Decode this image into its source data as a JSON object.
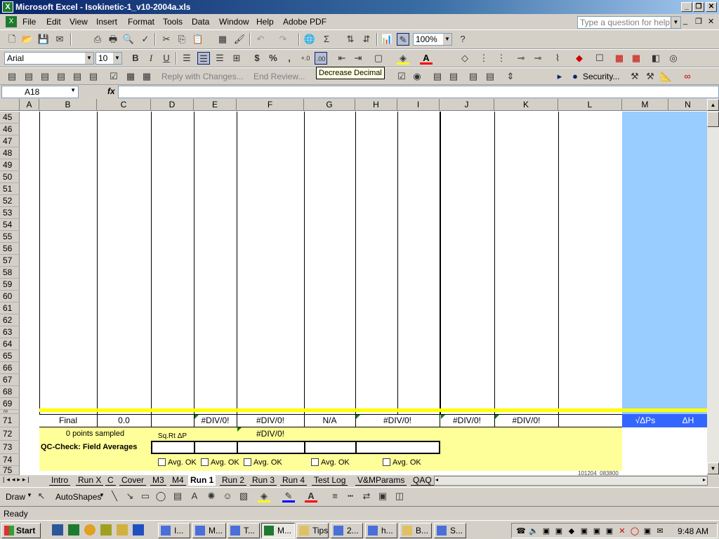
{
  "title": "Microsoft Excel - Isokinetic-1_v10-2004a.xls",
  "menu": [
    "File",
    "Edit",
    "View",
    "Insert",
    "Format",
    "Tools",
    "Data",
    "Window",
    "Help",
    "Adobe PDF"
  ],
  "help_placeholder": "Type a question for help",
  "toolbar": {
    "zoom": "100%",
    "font": "Arial",
    "size": "10",
    "reply_label": "Reply with Changes...",
    "end_review_label": "End Review...",
    "security_label": "Security...",
    "tooltip": "Decrease Decimal"
  },
  "namebox": "A18",
  "fx_label": "fx",
  "columns": [
    "A",
    "B",
    "C",
    "D",
    "E",
    "F",
    "G",
    "H",
    "I",
    "J",
    "K",
    "L",
    "M",
    "N"
  ],
  "rows": [
    "45",
    "46",
    "47",
    "48",
    "49",
    "50",
    "51",
    "52",
    "53",
    "54",
    "55",
    "56",
    "57",
    "58",
    "59",
    "60",
    "61",
    "62",
    "63",
    "64",
    "65",
    "66",
    "67",
    "68",
    "69",
    "70",
    "71",
    "72",
    "73",
    "74",
    "75"
  ],
  "row71": {
    "B": "Final",
    "C": "0.0",
    "E": "#DIV/0!",
    "F": "#DIV/0!",
    "G": "N/A",
    "HI": "#DIV/0!",
    "J": "#DIV/0!",
    "K": "#DIV/0!",
    "M": "√ΔPs",
    "N": "ΔH"
  },
  "row72": {
    "B": "0 points sampled",
    "D": "Sq.Rt ΔP",
    "F": "#DIV/0!"
  },
  "row73": {
    "B": "QC-Check: Field Averages"
  },
  "row74": {
    "checks": [
      "Avg. OK",
      "Avg. OK",
      "Avg. OK",
      "Avg. OK",
      "Avg. OK"
    ]
  },
  "row75_text": "101204_083800",
  "sheet_tabs": [
    "Intro",
    "Run X",
    "C",
    "Cover",
    "M3",
    "M4",
    "Run 1",
    "Run 2",
    "Run 3",
    "Run 4",
    "Test Log",
    "V&MParams",
    "QAQ"
  ],
  "active_tab": "Run 1",
  "drawbar": {
    "draw": "Draw",
    "autoshapes": "AutoShapes"
  },
  "status": "Ready",
  "taskbar": {
    "start": "Start",
    "tasks": [
      "I...",
      "M...",
      "T...",
      "M...",
      "Tips",
      "2...",
      "h...",
      "B...",
      "S..."
    ],
    "clock": "9:48 AM"
  }
}
